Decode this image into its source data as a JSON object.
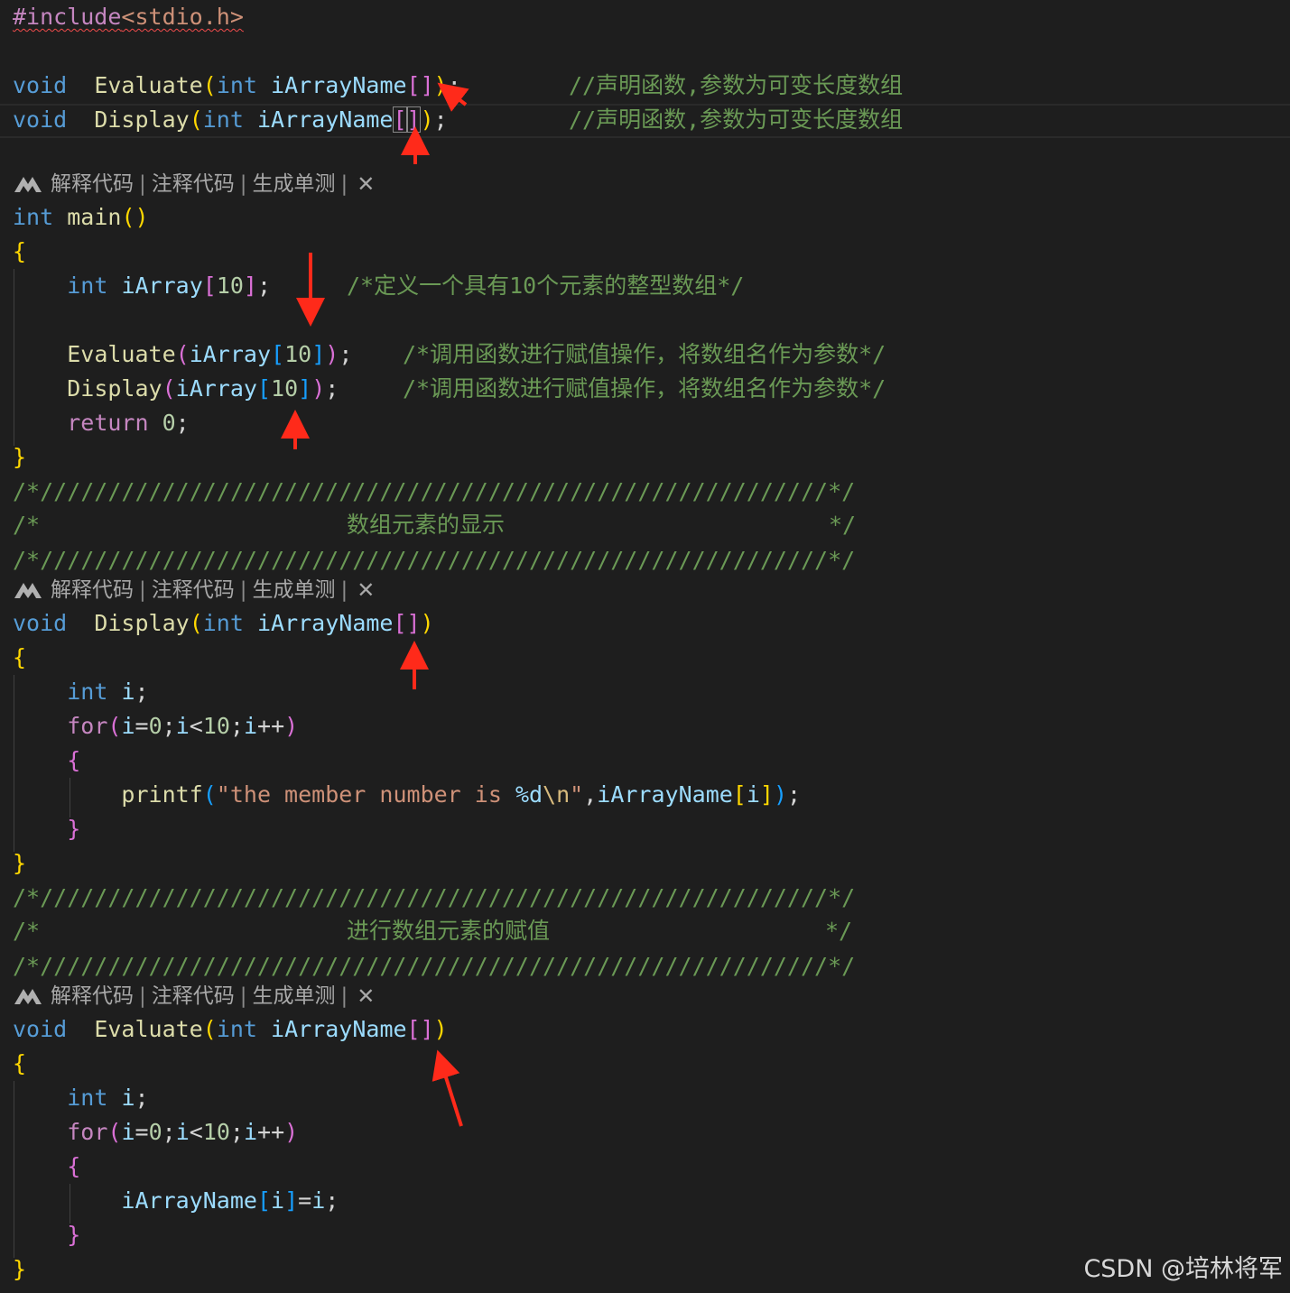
{
  "code": {
    "include": {
      "directive": "#include",
      "header": "<stdio.h>"
    },
    "decl_evaluate": {
      "type": "void",
      "name": "Evaluate",
      "param_type": "int",
      "param": "iArrayName",
      "comment": "//声明函数,参数为可变长度数组"
    },
    "decl_display": {
      "type": "void",
      "name": "Display",
      "param_type": "int",
      "param": "iArrayName",
      "comment": "//声明函数,参数为可变长度数组"
    },
    "main": {
      "type": "int",
      "name": "main",
      "array_type": "int",
      "array_name": "iArray",
      "array_size": "10",
      "array_comment": "/*定义一个具有10个元素的整型数组*/",
      "call_evaluate": "Evaluate",
      "call_display": "Display",
      "call_comment_1": "/*调用函数进行赋值操作，将数组名作为参数*/",
      "call_comment_2": "/*调用函数进行赋值操作，将数组名作为参数*/",
      "return_kw": "return",
      "return_val": "0"
    },
    "banner_rule": "/*//////////////////////////////////////////////////////////*/",
    "banner_display": {
      "open": "/*",
      "title": "数组元素的显示",
      "close": "*/"
    },
    "banner_evaluate": {
      "open": "/*",
      "title": "进行数组元素的赋值",
      "close": "*/"
    },
    "display_def": {
      "type": "void",
      "name": "Display",
      "param_type": "int",
      "param": "iArrayName",
      "local_type": "int",
      "local": "i",
      "for_kw": "for",
      "loop_i": "i",
      "loop_init": "0",
      "loop_limit": "10",
      "printf": "printf",
      "fmt_text": "\"the member number is ",
      "fmt_spec": "%d",
      "fmt_esc": "\\n",
      "fmt_end": "\""
    },
    "evaluate_def": {
      "type": "void",
      "name": "Evaluate",
      "param_type": "int",
      "param": "iArrayName",
      "local_type": "int",
      "local": "i",
      "for_kw": "for",
      "loop_i": "i",
      "loop_init": "0",
      "loop_limit": "10"
    }
  },
  "codelens": {
    "explain": "解释代码",
    "comment": "注释代码",
    "unittest": "生成单测",
    "separator": "|",
    "close": "✕",
    "logo_icon": "marscode-logo-icon",
    "close_icon": "close-icon"
  },
  "watermark": "CSDN @培林将军",
  "colors": {
    "background": "#1e1e1e",
    "keyword": "#569cd6",
    "function": "#dcdcaa",
    "variable": "#9cdcfe",
    "comment": "#6a9955",
    "control": "#c586c0",
    "arrow": "#ff2a1a"
  }
}
